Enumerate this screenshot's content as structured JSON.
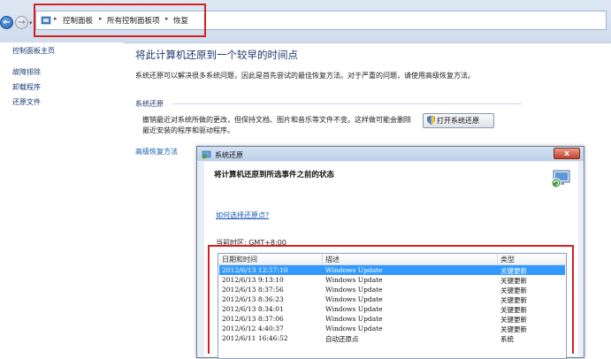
{
  "address_bar": {
    "crumbs": [
      "控制面板",
      "所有控制面板项",
      "恢复"
    ]
  },
  "left_pane": {
    "home": "控制面板主页",
    "links": [
      "故障排除",
      "卸载程序",
      "还原文件"
    ],
    "advanced": "高级恢复方法"
  },
  "main": {
    "title": "将此计算机还原到一个较早的时间点",
    "description": "系统还原可以解决很多系统问题，因此是首先尝试的最佳恢复方法。对于严重的问题，请使用高级恢复方法。",
    "section_label": "系统还原",
    "section_desc": "撤销最近对系统所做的更改，但保持文档、图片和音乐等文件不变。这样做可能会删除最近安装的程序和驱动程序。",
    "open_button": "打开系统还原"
  },
  "dialog": {
    "title": "系统还原",
    "close_label": "x",
    "heading": "将计算机还原到所选事件之前的状态",
    "howto_link": "如何选择还原点?",
    "timezone": "当前时区: GMT+8:00",
    "columns": [
      "日期和时间",
      "描述",
      "类型"
    ],
    "rows": [
      {
        "date": "2012/6/13 12:57:10",
        "desc": "Windows Update",
        "type": "关键更新",
        "selected": true
      },
      {
        "date": "2012/6/13 9:13:10",
        "desc": "Windows Update",
        "type": "关键更新"
      },
      {
        "date": "2012/6/13 8:37:56",
        "desc": "Windows Update",
        "type": "关键更新"
      },
      {
        "date": "2012/6/13 8:36:23",
        "desc": "Windows Update",
        "type": "关键更新"
      },
      {
        "date": "2012/6/13 8:34:01",
        "desc": "Windows Update",
        "type": "关键更新"
      },
      {
        "date": "2012/6/13 8:37:06",
        "desc": "Windows Update",
        "type": "关键更新"
      },
      {
        "date": "2012/6/12 4:40:37",
        "desc": "Windows Update",
        "type": "关键更新"
      },
      {
        "date": "2012/6/11 16:46:52",
        "desc": "自动还原点",
        "type": "系统"
      }
    ]
  },
  "colors": {
    "highlight_box": "#d42020",
    "selected_row": "#3399ff",
    "title_text": "#1e3a6e"
  }
}
